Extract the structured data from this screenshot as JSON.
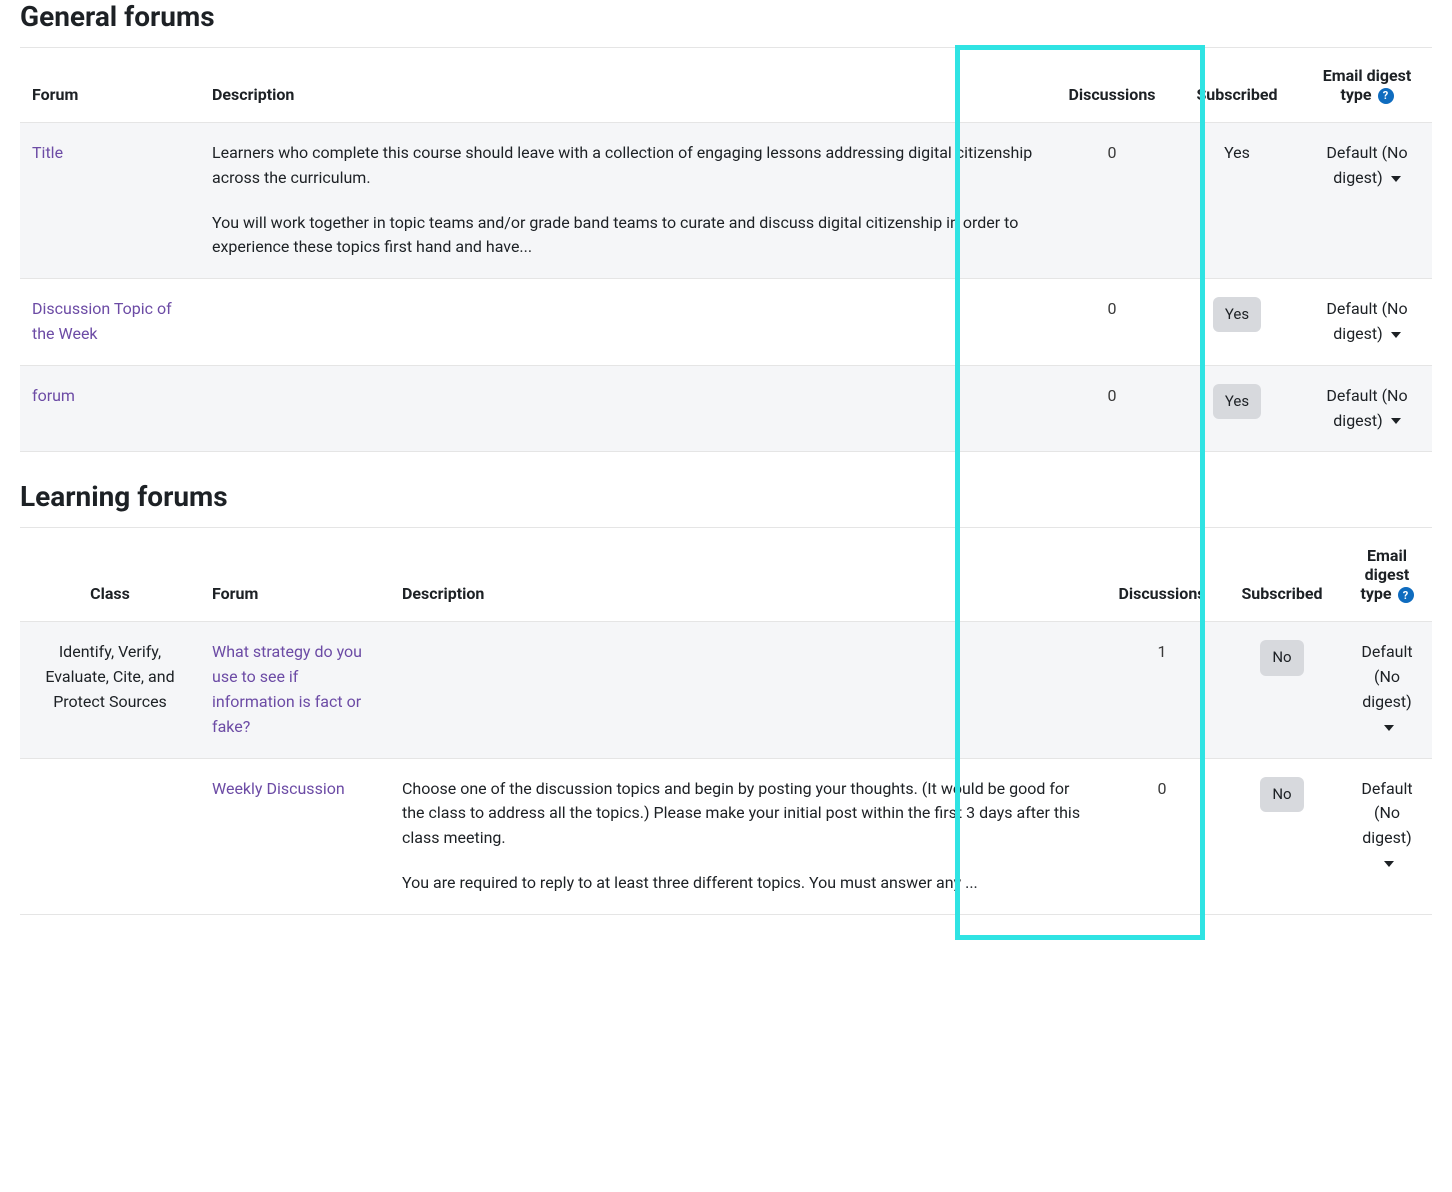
{
  "sections": {
    "general": {
      "heading": "General forums",
      "headers": {
        "forum": "Forum",
        "description": "Description",
        "discussions": "Discussions",
        "subscribed": "Subscribed",
        "digest": "Email digest type"
      },
      "rows": [
        {
          "forum": "Title",
          "desc1": "Learners who complete this course should leave with a collection of engaging lessons addressing digital citizenship across the curriculum.",
          "desc2": "You will work together in topic teams and/or grade band teams to curate and discuss digital citizenship in order to experience these topics first hand and have...",
          "discussions": "0",
          "subscribed": "Yes",
          "subscribed_pill": false,
          "digest": "Default (No digest)"
        },
        {
          "forum": "Discussion Topic of the Week",
          "desc1": "",
          "desc2": "",
          "discussions": "0",
          "subscribed": "Yes",
          "subscribed_pill": true,
          "digest": "Default (No digest)"
        },
        {
          "forum": "forum",
          "desc1": "",
          "desc2": "",
          "discussions": "0",
          "subscribed": "Yes",
          "subscribed_pill": true,
          "digest": "Default (No digest)"
        }
      ]
    },
    "learning": {
      "heading": "Learning forums",
      "headers": {
        "class": "Class",
        "forum": "Forum",
        "description": "Description",
        "discussions": "Discussions",
        "subscribed": "Subscribed",
        "digest": "Email digest type"
      },
      "rows": [
        {
          "class": "Identify, Verify, Evaluate, Cite, and Protect Sources",
          "forum": "What strategy do you use to see if information is fact or fake?",
          "desc1": "",
          "desc2": "",
          "discussions": "1",
          "subscribed": "No",
          "digest": "Default (No digest)"
        },
        {
          "class": "",
          "forum": "Weekly Discussion",
          "desc1": "Choose one of the discussion topics and begin by posting your thoughts. (It would be good for the class to address all the topics.)  Please make your initial post within the first 3 days after this class meeting.",
          "desc2": "You are required to reply to at least three different topics. You must answer any ...",
          "discussions": "0",
          "subscribed": "No",
          "digest": "Default (No digest)"
        }
      ]
    }
  },
  "help_glyph": "?"
}
